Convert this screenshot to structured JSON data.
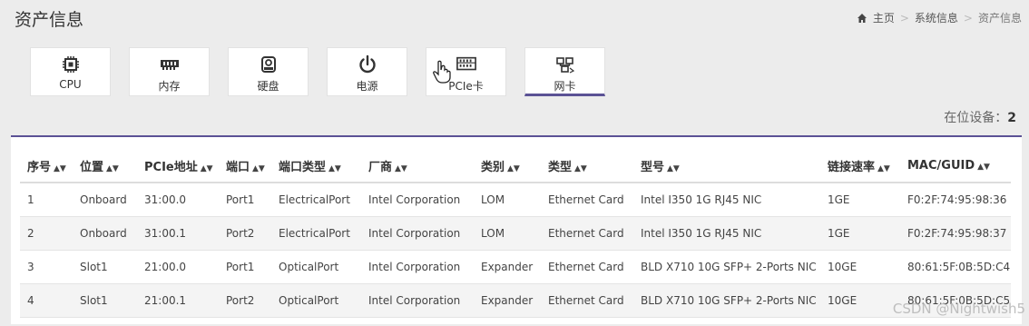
{
  "header": {
    "title": "资产信息"
  },
  "breadcrumb": {
    "home": "主页",
    "section": "系统信息",
    "current": "资产信息"
  },
  "tabs": [
    {
      "label": "CPU",
      "icon": "cpu-icon"
    },
    {
      "label": "内存",
      "icon": "memory-icon"
    },
    {
      "label": "硬盘",
      "icon": "disk-icon"
    },
    {
      "label": "电源",
      "icon": "power-icon"
    },
    {
      "label": "PCIe卡",
      "icon": "pcie-icon"
    },
    {
      "label": "网卡",
      "icon": "network-card-icon",
      "active": true
    }
  ],
  "summary": {
    "label": "在位设备：",
    "count": "2"
  },
  "table": {
    "headers": [
      "序号",
      "位置",
      "PCIe地址",
      "端口",
      "端口类型",
      "厂商",
      "类别",
      "类型",
      "型号",
      "链接速率",
      "MAC/GUID"
    ],
    "rows": [
      [
        "1",
        "Onboard",
        "31:00.0",
        "Port1",
        "ElectricalPort",
        "Intel Corporation",
        "LOM",
        "Ethernet Card",
        "Intel I350 1G RJ45 NIC",
        "1GE",
        "F0:2F:74:95:98:36"
      ],
      [
        "2",
        "Onboard",
        "31:00.1",
        "Port2",
        "ElectricalPort",
        "Intel Corporation",
        "LOM",
        "Ethernet Card",
        "Intel I350 1G RJ45 NIC",
        "1GE",
        "F0:2F:74:95:98:37"
      ],
      [
        "3",
        "Slot1",
        "21:00.0",
        "Port1",
        "OpticalPort",
        "Intel Corporation",
        "Expander",
        "Ethernet Card",
        "BLD X710 10G SFP+ 2-Ports NIC",
        "10GE",
        "80:61:5F:0B:5D:C4"
      ],
      [
        "4",
        "Slot1",
        "21:00.1",
        "Port2",
        "OpticalPort",
        "Intel Corporation",
        "Expander",
        "Ethernet Card",
        "BLD X710 10G SFP+ 2-Ports NIC",
        "10GE",
        "80:61:5F:0B:5D:C5"
      ]
    ]
  },
  "watermark": "CSDN @Nightwish5",
  "colors": {
    "accent": "#5b5295"
  }
}
